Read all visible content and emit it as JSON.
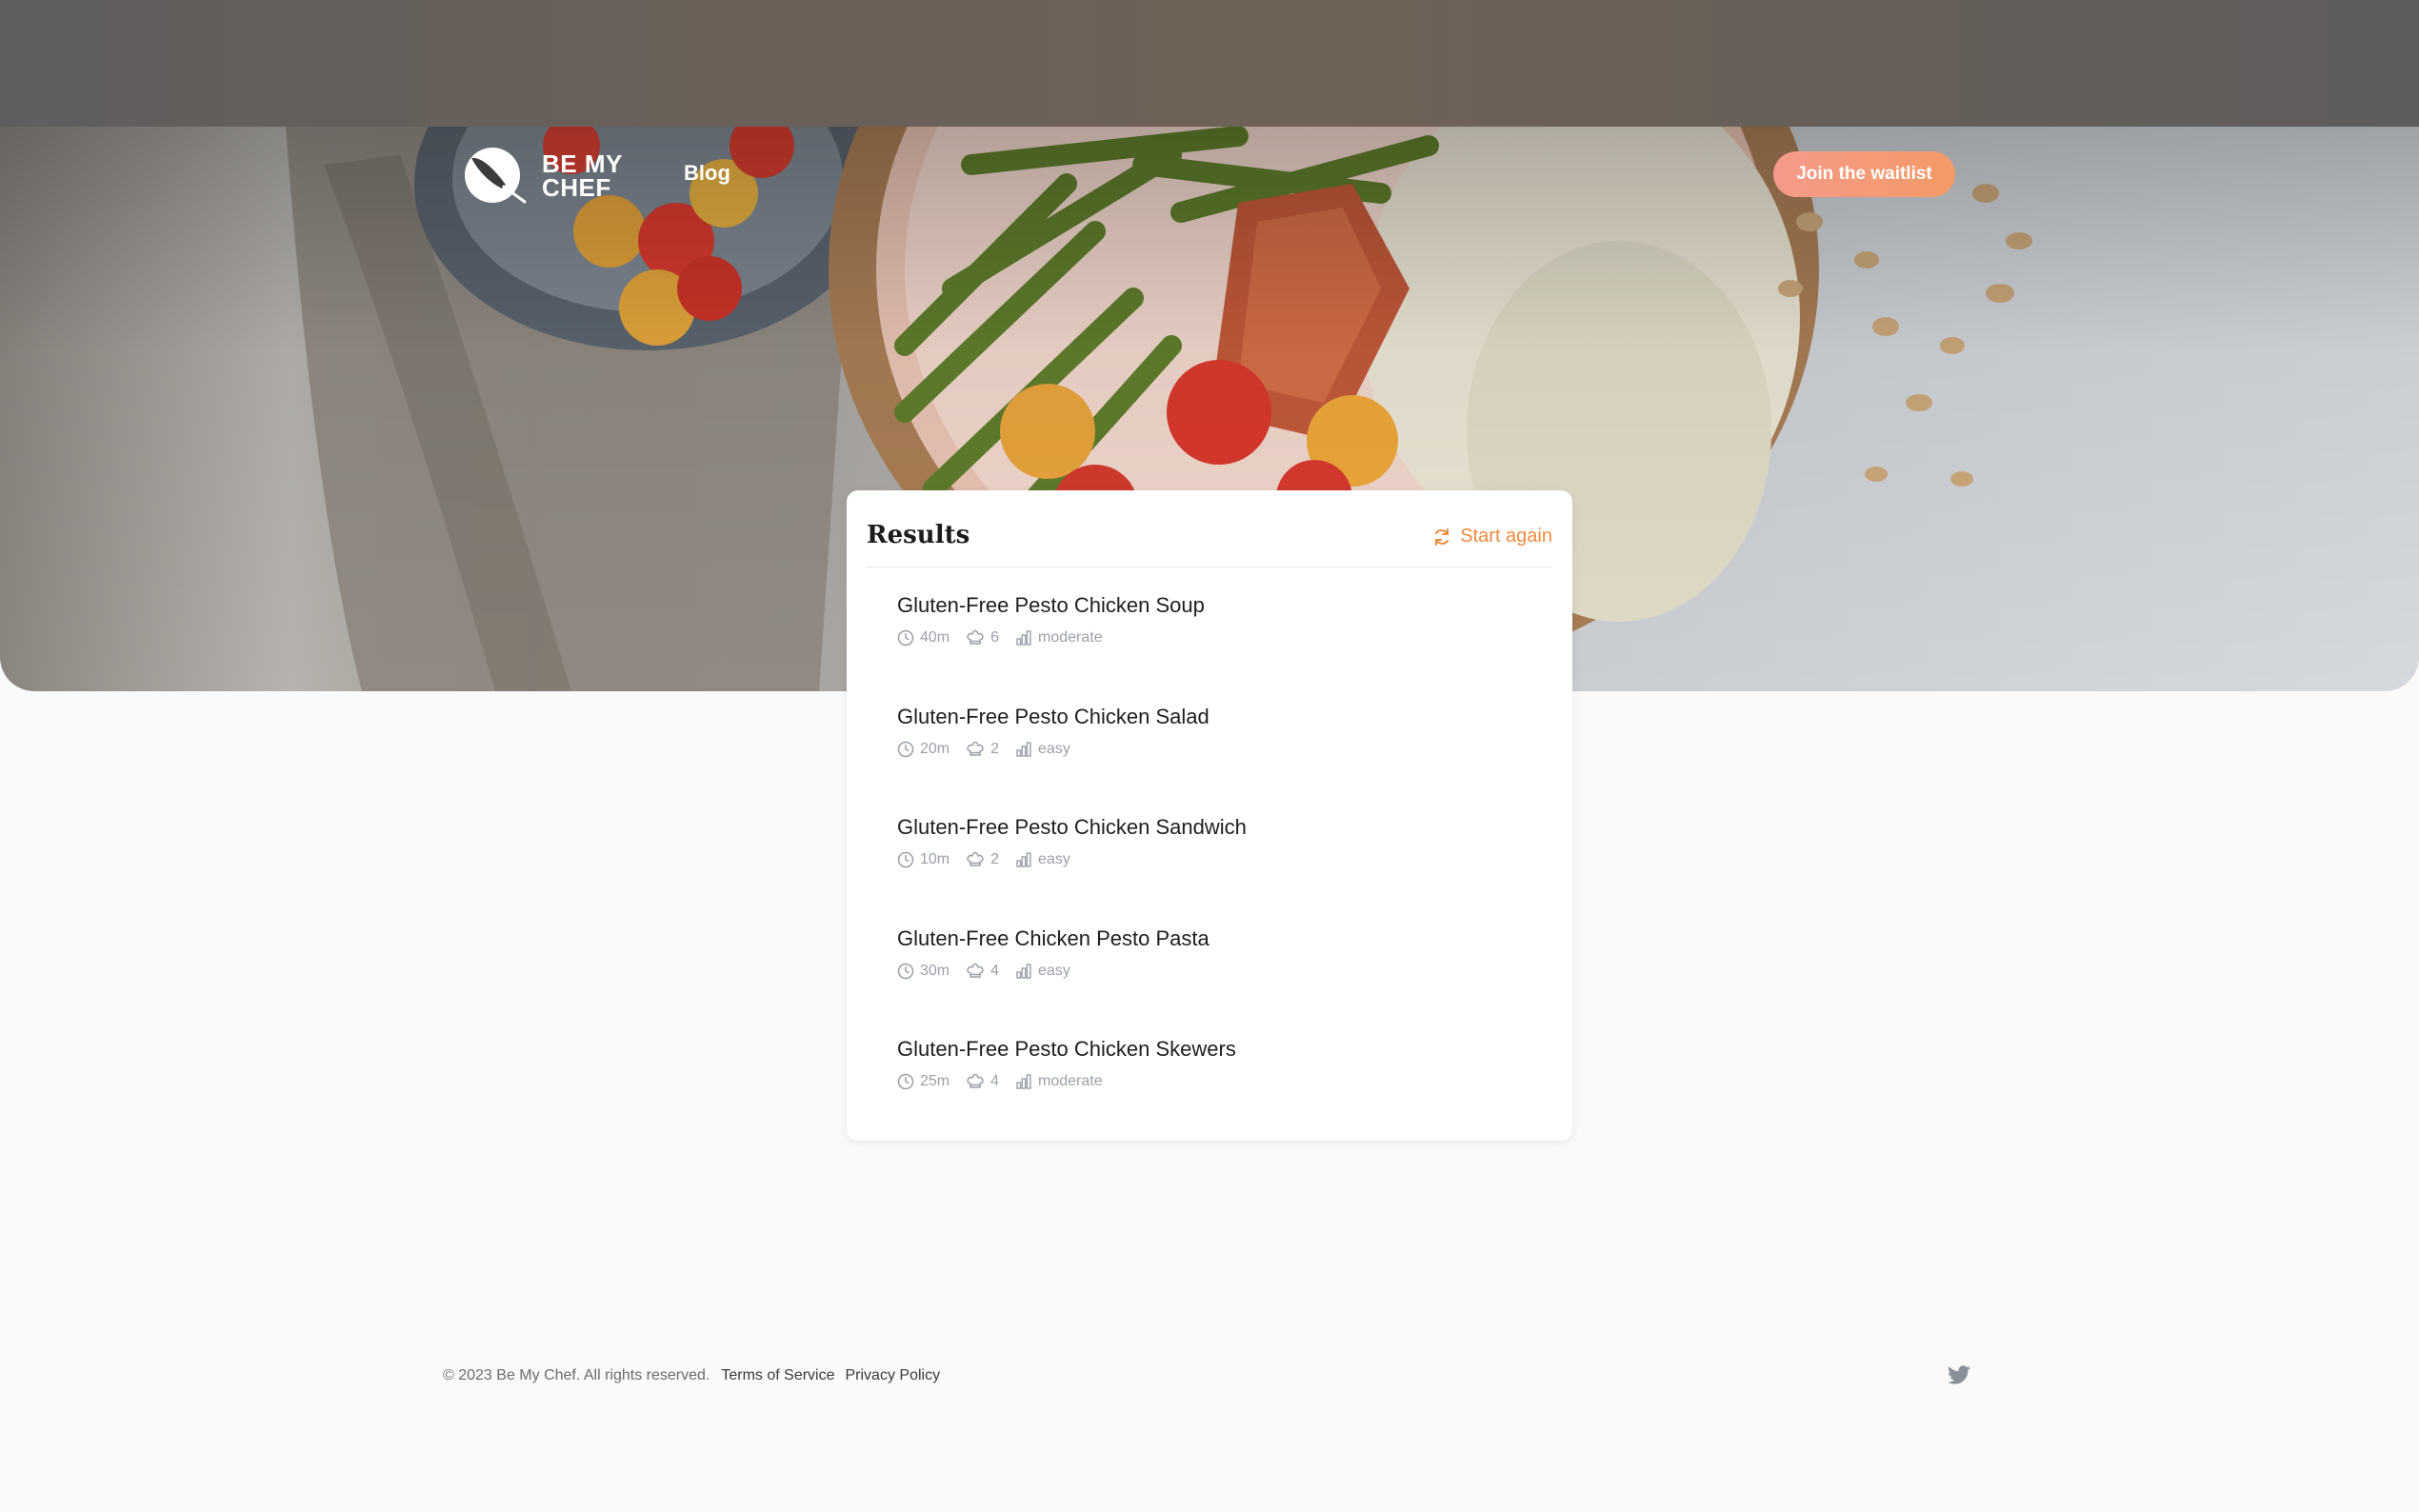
{
  "brand": {
    "name_line1": "BE MY",
    "name_line2": "CHEF",
    "logo_icon": "knife-in-circle-icon"
  },
  "nav": {
    "blog_label": "Blog",
    "waitlist_label": "Join the waitlist"
  },
  "results": {
    "title": "Results",
    "start_again_label": "Start again",
    "items": [
      {
        "title": "Gluten-Free Pesto Chicken Soup",
        "time": "40m",
        "servings": "6",
        "difficulty": "moderate"
      },
      {
        "title": "Gluten-Free Pesto Chicken Salad",
        "time": "20m",
        "servings": "2",
        "difficulty": "easy"
      },
      {
        "title": "Gluten-Free Pesto Chicken Sandwich",
        "time": "10m",
        "servings": "2",
        "difficulty": "easy"
      },
      {
        "title": "Gluten-Free Chicken Pesto Pasta",
        "time": "30m",
        "servings": "4",
        "difficulty": "easy"
      },
      {
        "title": "Gluten-Free Pesto Chicken Skewers",
        "time": "25m",
        "servings": "4",
        "difficulty": "moderate"
      }
    ]
  },
  "footer": {
    "copyright": "© 2023 Be My Chef. All rights reserved.",
    "terms_label": "Terms of Service",
    "privacy_label": "Privacy Policy",
    "social_icon": "twitter-icon"
  },
  "colors": {
    "accent": "#ee8a3c",
    "button_start": "#f59a8a",
    "button_end": "#f39a66",
    "meta_text": "#9aa0a8"
  }
}
